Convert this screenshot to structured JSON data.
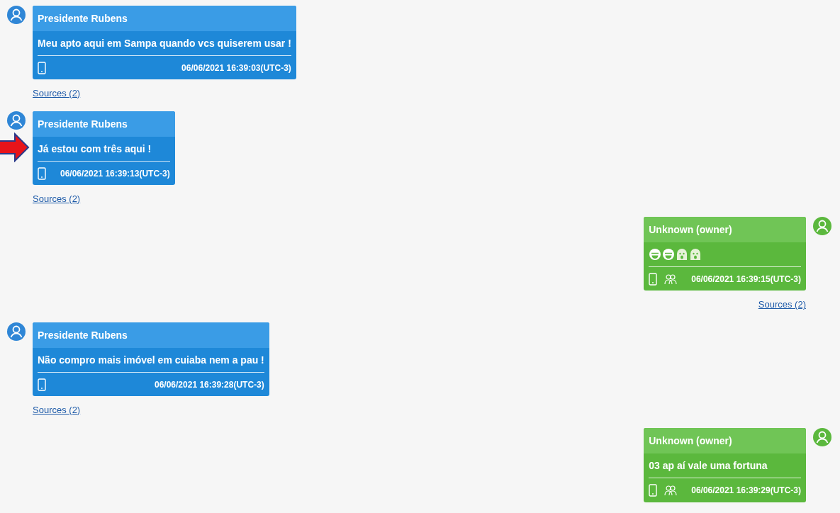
{
  "messages": [
    {
      "kind": "incoming",
      "sender": "Presidente Rubens",
      "body": {
        "kind": "text",
        "text": "Meu apto aqui em Sampa quando vcs quiserem usar !"
      },
      "group": false,
      "timestamp": "06/06/2021 16:39:03(UTC-3)",
      "sources": "Sources (2)",
      "highlighted": false
    },
    {
      "kind": "incoming",
      "sender": "Presidente Rubens",
      "body": {
        "kind": "text",
        "text": "Já estou com três aqui !"
      },
      "group": false,
      "timestamp": "06/06/2021 16:39:13(UTC-3)",
      "sources": "Sources (2)",
      "highlighted": true
    },
    {
      "kind": "outgoing",
      "sender": "Unknown (owner)",
      "body": {
        "kind": "emojis",
        "emojis": [
          {
            "kind": "grin"
          },
          {
            "kind": "grin"
          },
          {
            "kind": "scared"
          },
          {
            "kind": "scared"
          }
        ]
      },
      "group": true,
      "timestamp": "06/06/2021 16:39:15(UTC-3)",
      "sources": "Sources (2)",
      "highlighted": false
    },
    {
      "kind": "incoming",
      "sender": "Presidente Rubens",
      "body": {
        "kind": "text",
        "text": "Não compro mais imóvel em cuiaba nem a pau !"
      },
      "group": false,
      "timestamp": "06/06/2021 16:39:28(UTC-3)",
      "sources": "Sources (2)",
      "highlighted": false
    },
    {
      "kind": "outgoing",
      "sender": "Unknown (owner)",
      "body": {
        "kind": "text",
        "text": "03 ap aí vale uma fortuna"
      },
      "group": true,
      "timestamp": "06/06/2021 16:39:29(UTC-3)",
      "highlighted": false
    }
  ]
}
